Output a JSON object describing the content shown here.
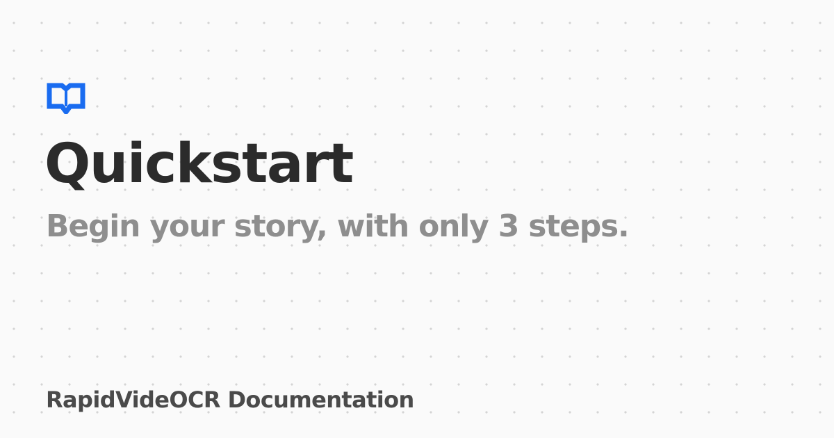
{
  "page": {
    "title": "Quickstart",
    "subtitle": "Begin your story, with only 3 steps.",
    "site_name": "RapidVideOCR Documentation",
    "logo_icon": "open-book-icon"
  },
  "colors": {
    "accent": "#1a6cf0",
    "title": "#2b2b2b",
    "subtitle": "#8e8e8e",
    "site_name": "#4a4a4a",
    "background": "#fafafa",
    "dots": "#d4d4d4"
  }
}
